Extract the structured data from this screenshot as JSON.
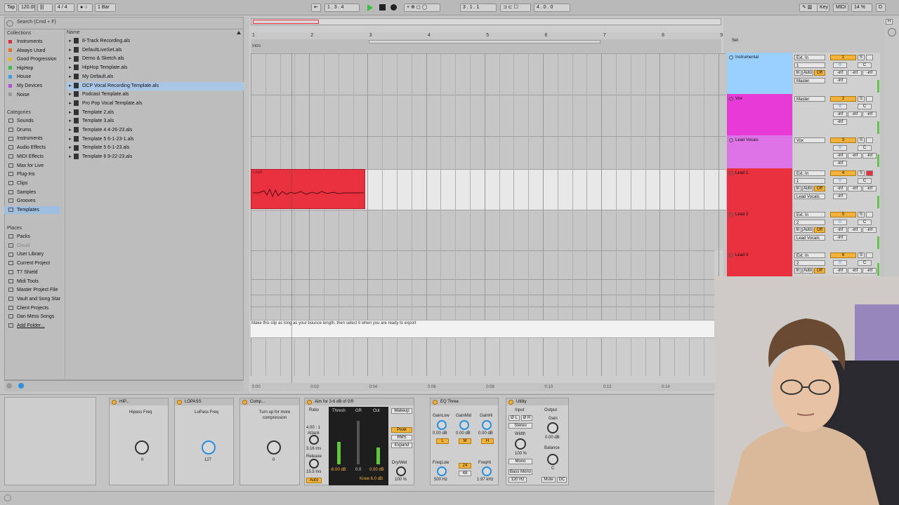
{
  "transport": {
    "tap": "Tap",
    "tempo": "120.00",
    "signature": "4 / 4",
    "quantize": "1 Bar",
    "position": "1 . 3 . 4",
    "loop_start": "3 . 1 . 1",
    "loop_length": "4 . 0 . 0",
    "key": "Key",
    "midi": "MIDI",
    "cpu": "14 %",
    "follow": "D"
  },
  "browser": {
    "search_placeholder": "Search (Cmd + F)",
    "collections_header": "Collections",
    "collections": [
      {
        "label": "Instruments",
        "color": "#e0303a"
      },
      {
        "label": "Always Used",
        "color": "#e8712a"
      },
      {
        "label": "Good Progression",
        "color": "#e8b72a"
      },
      {
        "label": "HipHop",
        "color": "#3ac040"
      },
      {
        "label": "House",
        "color": "#3a9de0"
      },
      {
        "label": "My Devices",
        "color": "#b050d8"
      },
      {
        "label": "Noise",
        "color": "#999999"
      }
    ],
    "categories_header": "Categories",
    "categories": [
      "Sounds",
      "Drums",
      "Instruments",
      "Audio Effects",
      "MIDI Effects",
      "Max for Live",
      "Plug-Ins",
      "Clips",
      "Samples",
      "Grooves",
      "Templates"
    ],
    "places_header": "Places",
    "places": [
      "Packs",
      "Cloud",
      "User Library",
      "Current Project",
      "T7 Shield",
      "Midi Tools",
      "Master Project File",
      "Vault and Song Star",
      "Client Projects",
      "Dan Mess Songs",
      "Add Folder..."
    ],
    "name_header": "Name",
    "files": [
      "8-Track Recording.als",
      "DefaultLiveSet.als",
      "Demo & Sketch.als",
      "HipHop Template.als",
      "My Default.als",
      "OCP Vocal Recording Template.als",
      "Podcast Template.als",
      "Pro Pop Vocal Template.als",
      "Template 2.als",
      "Template 3.als",
      "Template 4 4-26-23.als",
      "Template 5 6-1-23-1.als",
      "Template 5 6-1-23.als",
      "Template 6 9-22-23.als"
    ]
  },
  "arrangement": {
    "bars": [
      "1",
      "2",
      "3",
      "4",
      "5",
      "6",
      "7",
      "8",
      "9"
    ],
    "locator": "Intro",
    "clip_name": "Lead",
    "export_note": "Make this clip as long as your bounce length, then select it when you are ready to export",
    "times": [
      "0:00",
      "0:02",
      "0:04",
      "0:06",
      "0:08",
      "0:10",
      "0:12",
      "0:14"
    ]
  },
  "tracks": [
    {
      "name": "Instrumental",
      "color": "#9ad0ff",
      "input": "Ext. In",
      "channel": "1",
      "output": "Master",
      "number": "1",
      "volume": "0",
      "pan": "C",
      "inf": "-inf"
    },
    {
      "name": "Vox",
      "color": "#e83ad6",
      "input": "Master",
      "channel": "",
      "output": "",
      "number": "2",
      "volume": "0",
      "pan": "C",
      "inf": "-inf"
    },
    {
      "name": "Lead Vocals",
      "color": "#dd73e6",
      "input": "Vox",
      "channel": "",
      "output": "",
      "number": "3",
      "volume": "0",
      "pan": "C",
      "inf": "-inf"
    },
    {
      "name": "Lead 1",
      "color": "#e8303e",
      "input": "Ext. In",
      "channel": "1",
      "output": "Lead Vocals",
      "number": "4",
      "volume": "0",
      "pan": "C",
      "inf": "-inf"
    },
    {
      "name": "Lead 2",
      "color": "#e8303e",
      "input": "Ext. In",
      "channel": "2",
      "output": "Lead Vocals",
      "number": "5",
      "volume": "0",
      "pan": "C",
      "inf": "-inf"
    },
    {
      "name": "Lead 3",
      "color": "#e8303e",
      "input": "Ext. In",
      "channel": "2",
      "output": "",
      "number": "6",
      "volume": "0",
      "pan": "C",
      "inf": "-inf"
    }
  ],
  "mixer_labels": {
    "in": "In",
    "auto": "Auto",
    "off": "Off",
    "solo": "S",
    "set": "Set"
  },
  "devices": {
    "hipass": {
      "title": "HIP...",
      "param": "Hipass Freq",
      "value": "0"
    },
    "lopass": {
      "title": "LOPASS",
      "param": "LoPass Freq",
      "value": "127"
    },
    "comp": {
      "title": "Comp...",
      "param": "Turn up for more compression",
      "value": "0"
    },
    "glue": {
      "title": "Aim for 3-6 dB of GR",
      "ratio_label": "Ratio",
      "ratio": "4.00 : 1",
      "attack_label": "Attack",
      "attack": "3.16 ms",
      "release_label": "Release",
      "release": "15.5 ms",
      "auto": "Auto",
      "thresh_label": "Thresh",
      "gr_label": "GR",
      "out_label": "Out",
      "thresh_val": "-6.00 dB",
      "gr_val": "0.0",
      "out_val": "0.00 dB",
      "knee": "Knee 6.0 dB",
      "makeup": "Makeup",
      "peak": "Peak",
      "rms": "RMS",
      "expand": "Expand",
      "drywet_label": "Dry/Wet",
      "drywet": "100 %"
    },
    "eq": {
      "title": "EQ Three",
      "gain_low": "GainLow",
      "gain_mid": "GainMid",
      "gain_hi": "GainHi",
      "low_val": "0.00 dB",
      "mid_val": "0.00 dB",
      "hi_val": "0.00 dB",
      "l": "L",
      "m": "M",
      "h": "H",
      "freq_low": "FreqLow",
      "freq_low_val": "500 Hz",
      "freq_hi": "FreqHi",
      "freq_hi_val": "1.97 kHz",
      "slope_a": "24",
      "slope_b": "48"
    },
    "utility": {
      "title": "Utility",
      "input": "Input",
      "output": "Output",
      "phase_l": "Ø L",
      "phase_r": "Ø R",
      "stereo": "Stereo",
      "gain": "Gain",
      "gain_val": "0.00 dB",
      "width": "Width",
      "width_val": "100 %",
      "mono": "Mono",
      "balance": "Balance",
      "balance_val": "C",
      "bass_mono": "Bass Mono",
      "bass_freq": "120 Hz",
      "mute": "Mute",
      "dc": "DC"
    }
  },
  "accent_orange": "#f3b23a",
  "accent_red": "#e8303e"
}
